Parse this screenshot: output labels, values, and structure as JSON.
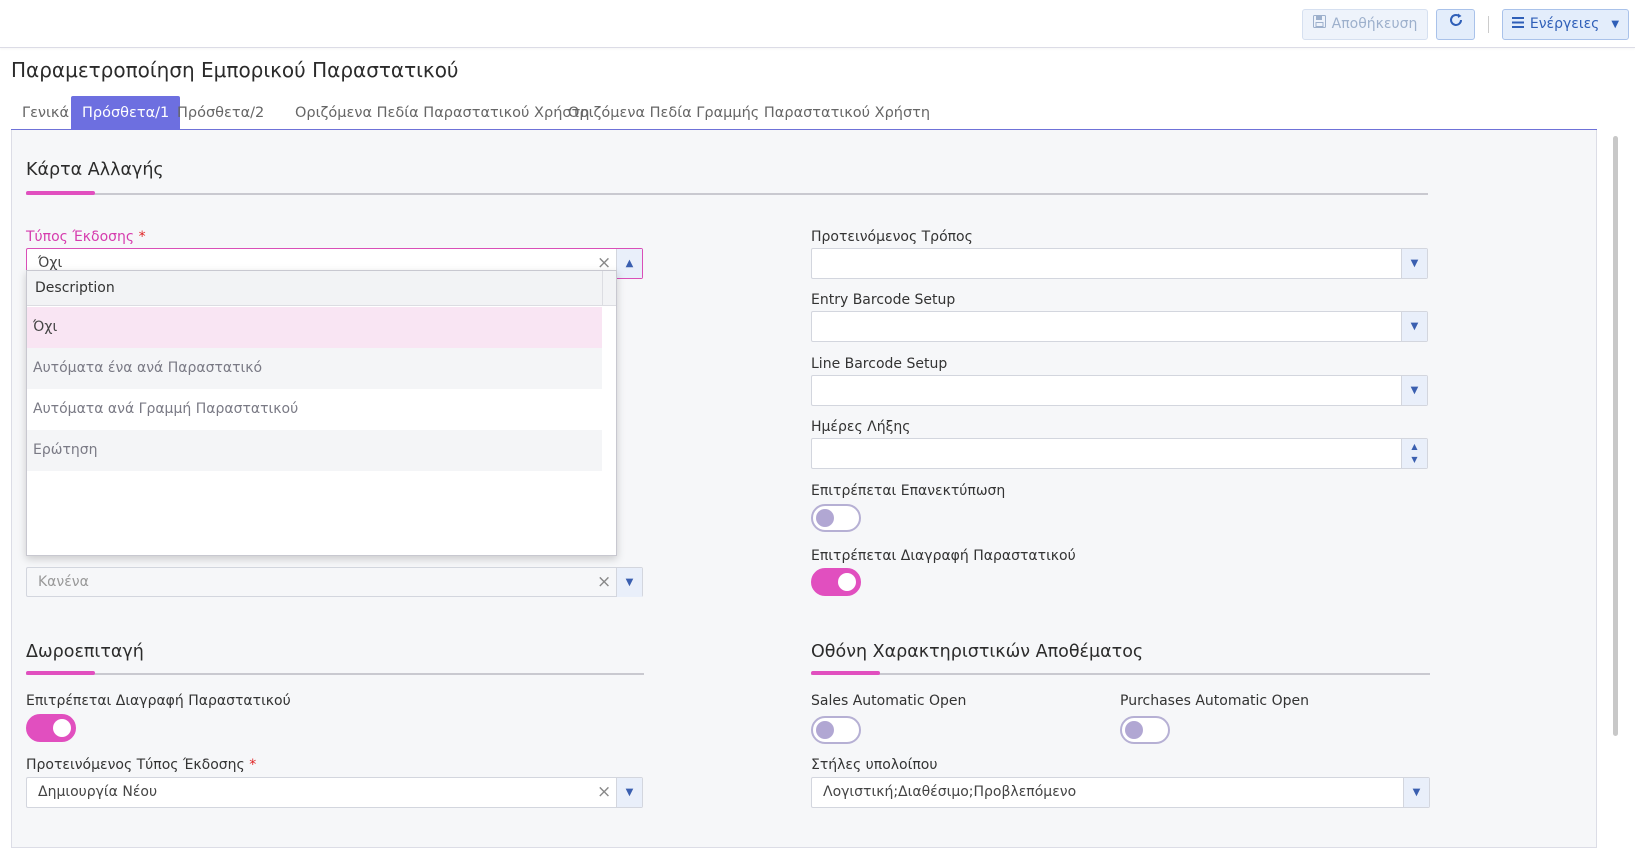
{
  "toolbar": {
    "save_label": "Αποθήκευση",
    "actions_label": "Ενέργειες"
  },
  "page": {
    "title": "Παραμετροποίηση Εμπορικού Παραστατικού"
  },
  "tabs": [
    {
      "label": "Γενικά",
      "active": false
    },
    {
      "label": "Πρόσθετα/1",
      "active": true
    },
    {
      "label": "Πρόσθετα/2",
      "active": false
    },
    {
      "label": "Οριζόμενα Πεδία Παραστατικού Χρήστη",
      "active": false
    },
    {
      "label": "Οριζόμενα Πεδία Γραμμής Παραστατικού Χρήστη",
      "active": false
    }
  ],
  "sections": {
    "change_card": {
      "title": "Κάρτα Αλλαγής",
      "issue_type": {
        "label": "Τύπος Έκδοσης",
        "required_mark": "*",
        "value": "Όχι"
      },
      "hidden_field_value": "Κανένα",
      "suggested_mode": {
        "label": "Προτεινόμενος Τρόπος",
        "value": ""
      },
      "entry_barcode": {
        "label": "Entry Barcode Setup",
        "value": ""
      },
      "line_barcode": {
        "label": "Line Barcode Setup",
        "value": ""
      },
      "expiry_days": {
        "label": "Ημέρες Λήξης",
        "value": ""
      },
      "allow_reprint": {
        "label": "Επιτρέπεται Επανεκτύπωση",
        "on": false
      },
      "allow_delete": {
        "label": "Επιτρέπεται Διαγραφή Παραστατικού",
        "on": true
      }
    },
    "gift_voucher": {
      "title": "Δωροεπιταγή",
      "allow_delete": {
        "label": "Επιτρέπεται Διαγραφή Παραστατικού",
        "on": true
      },
      "suggested_issue_type": {
        "label": "Προτεινόμενος Τύπος Έκδοσης",
        "required_mark": "*",
        "value": "Δημιουργία Νέου"
      }
    },
    "stock_screen": {
      "title": "Οθόνη Χαρακτηριστικών Αποθέματος",
      "sales_auto_open": {
        "label": "Sales Automatic Open",
        "on": false
      },
      "purchases_auto_open": {
        "label": "Purchases Automatic Open",
        "on": false
      },
      "balance_columns": {
        "label": "Στήλες υπολοίπου",
        "value": "Λογιστική;Διαθέσιμο;Προβλεπόμενο"
      }
    }
  },
  "dropdown": {
    "header": "Description",
    "options": [
      {
        "label": "Όχι",
        "selected": true
      },
      {
        "label": "Αυτόματα ένα ανά Παραστατικό",
        "selected": false
      },
      {
        "label": "Αυτόματα ανά Γραμμή Παραστατικού",
        "selected": false
      },
      {
        "label": "Ερώτηση",
        "selected": false
      }
    ]
  },
  "colors": {
    "accent": "#e14fbf",
    "tab_active": "#6d6fe0",
    "button_blue": "#2f5fb8"
  }
}
